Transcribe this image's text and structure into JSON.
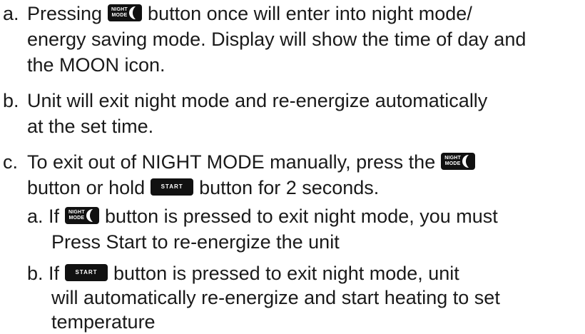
{
  "buttons": {
    "night_mode_line1": "NIGHT",
    "night_mode_line2": "MODE",
    "start": "START"
  },
  "items": {
    "a": {
      "marker": "a.",
      "l1_pre": "Pressing",
      "l1_post": "button once will enter into night mode/",
      "l2": "energy saving mode. Display will show the time of day and",
      "l3": "the MOON icon."
    },
    "b": {
      "marker": "b.",
      "l1": "Unit will exit night mode and re-energize automatically",
      "l2": "at the set time."
    },
    "c": {
      "marker": "c.",
      "l1": "To exit out of NIGHT MODE manually, press the",
      "l2_a": "button or hold",
      "l2_b": "button for 2 seconds.",
      "sub_a": {
        "marker": "a.",
        "l1_pre": "If",
        "l1_post": "button is pressed to exit night mode, you must",
        "l2": "Press Start to re-energize the unit"
      },
      "sub_b": {
        "marker": "b.",
        "l1_pre": "If",
        "l1_post": "button is pressed to exit night mode, unit",
        "l2": "will automatically re-energize and start heating to set",
        "l3": "temperature"
      }
    }
  }
}
